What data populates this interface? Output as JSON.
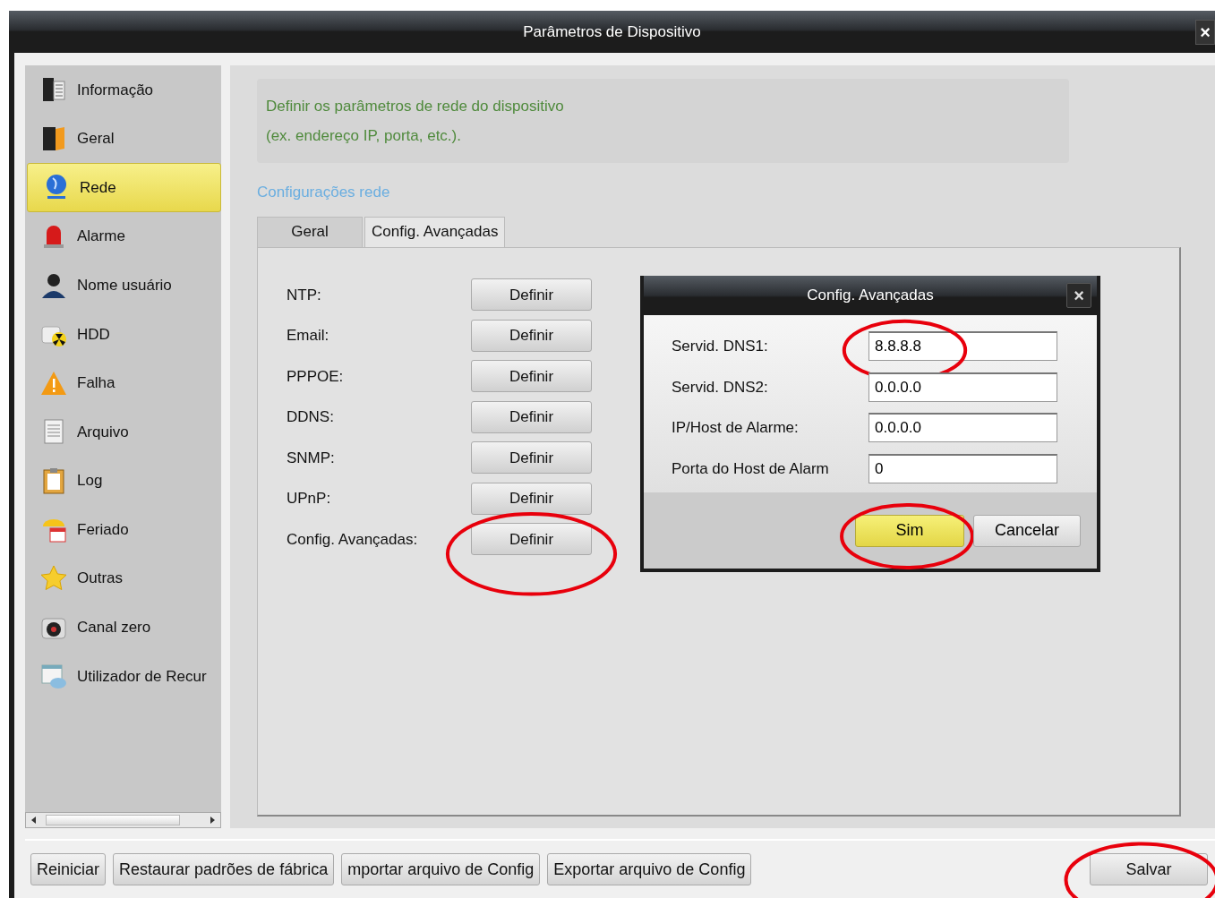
{
  "window": {
    "title": "Parâmetros de Dispositivo",
    "close": "×"
  },
  "sidebar": {
    "items": [
      {
        "label": "Informação",
        "selected": false
      },
      {
        "label": "Geral",
        "selected": false
      },
      {
        "label": "Rede",
        "selected": true
      },
      {
        "label": "Alarme",
        "selected": false
      },
      {
        "label": "Nome usuário",
        "selected": false
      },
      {
        "label": "HDD",
        "selected": false
      },
      {
        "label": "Falha",
        "selected": false
      },
      {
        "label": "Arquivo",
        "selected": false
      },
      {
        "label": "Log",
        "selected": false
      },
      {
        "label": "Feriado",
        "selected": false
      },
      {
        "label": "Outras",
        "selected": false
      },
      {
        "label": "Canal zero",
        "selected": false
      },
      {
        "label": "Utilizador de Recur",
        "selected": false
      }
    ]
  },
  "description": [
    "Definir os parâmetros de rede do dispositivo",
    "(ex. endereço IP, porta, etc.)."
  ],
  "section_title": "Configurações rede",
  "tabs": [
    {
      "label": "Geral",
      "selected": false
    },
    {
      "label": "Config. Avançadas",
      "selected": true
    }
  ],
  "settings": [
    {
      "label": "NTP:",
      "button": "Definir",
      "highlighted": false
    },
    {
      "label": "Email:",
      "button": "Definir",
      "highlighted": false
    },
    {
      "label": "PPPOE:",
      "button": "Definir",
      "highlighted": false
    },
    {
      "label": "DDNS:",
      "button": "Definir",
      "highlighted": false
    },
    {
      "label": "SNMP:",
      "button": "Definir",
      "highlighted": false
    },
    {
      "label": "UPnP:",
      "button": "Definir",
      "highlighted": false
    },
    {
      "label": "Config. Avançadas:",
      "button": "Definir",
      "highlighted": true
    }
  ],
  "dialog": {
    "title": "Config. Avançadas",
    "close": "×",
    "fields": [
      {
        "label": "Servid. DNS1:",
        "value": "8.8.8.8",
        "highlighted": true
      },
      {
        "label": "Servid. DNS2:",
        "value": "0.0.0.0",
        "highlighted": false
      },
      {
        "label": "IP/Host de Alarme:",
        "value": "0.0.0.0",
        "highlighted": false
      },
      {
        "label": "Porta do Host de Alarm",
        "value": "0",
        "highlighted": false
      }
    ],
    "buttons": [
      {
        "label": "Sim",
        "kind": "primary",
        "highlighted": true
      },
      {
        "label": "Cancelar",
        "kind": "secondary",
        "highlighted": false
      }
    ]
  },
  "footer": {
    "buttons": [
      {
        "label": "Reiniciar",
        "highlighted": false
      },
      {
        "label": "Restaurar padrões de fábrica",
        "highlighted": false
      },
      {
        "label": "mportar arquivo de Config",
        "highlighted": false
      },
      {
        "label": "Exportar arquivo de Config",
        "highlighted": false
      }
    ],
    "save": {
      "label": "Salvar",
      "highlighted": true
    }
  }
}
